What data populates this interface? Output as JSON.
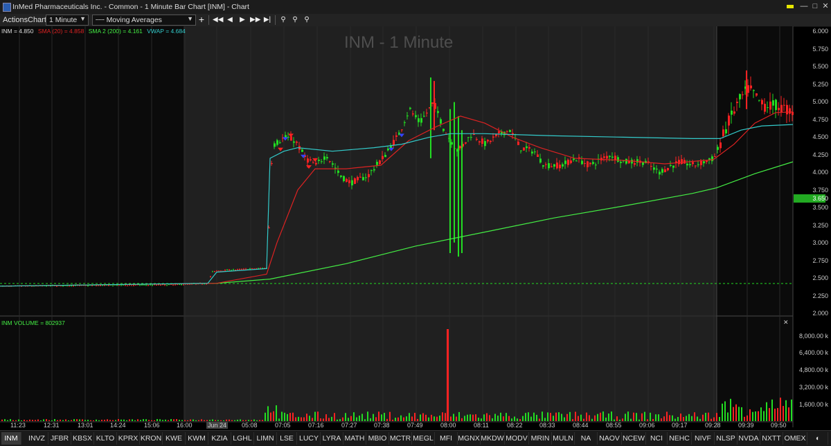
{
  "window": {
    "title": "InMed Pharmaceuticals Inc. - Common - 1 Minute Bar Chart [INM] - Chart"
  },
  "toolbar": {
    "actions": "Actions",
    "chart": "Chart",
    "interval": "1 Minute",
    "indicator": "Moving Averages"
  },
  "chart": {
    "watermark": "INM - 1 Minute",
    "legend": {
      "symbol": "INM = 4.850",
      "sma20": "SMA (20) = 4.858",
      "sma200": "SMA 2 (200) = 4.161",
      "vwap": "VWAP = 4.684"
    },
    "price_ticks": [
      "6.000",
      "5.750",
      "5.500",
      "5.250",
      "5.000",
      "4.750",
      "4.500",
      "4.250",
      "4.000",
      "3.750",
      "3.650",
      "3.500",
      "3.250",
      "3.000",
      "2.750",
      "2.500",
      "2.250",
      "2.000"
    ],
    "price_marker": "3.650",
    "volume_legend": "INM VOLUME = 802937",
    "volume_ticks": [
      "8,000.00 k",
      "6,400.00 k",
      "4,800.00 k",
      "3,200.00 k",
      "1,600.00 k"
    ],
    "time_ticks": [
      "11:23",
      "12:31",
      "13:01",
      "14:24",
      "15:06",
      "16:00",
      "Jun 24",
      "05:08",
      "07:05",
      "07:16",
      "07:27",
      "07:38",
      "07:49",
      "08:00",
      "08:11",
      "08:22",
      "08:33",
      "08:44",
      "08:55",
      "09:06",
      "09:17",
      "09:28",
      "09:39",
      "09:50"
    ],
    "colors": {
      "up": "#22dd22",
      "down": "#ff2222",
      "sma20": "#dd2222",
      "sma200": "#44ee44",
      "vwap": "#33cccc",
      "marker_bg": "#22aa22"
    }
  },
  "tabs": [
    "INM",
    "INVZ",
    "JFBR",
    "KBSX",
    "KLTO",
    "KPRX",
    "KRON",
    "KWE",
    "KWM",
    "KZIA",
    "LGHL",
    "LIMN",
    "LSE",
    "LUCY",
    "LYRA",
    "MATH",
    "MBIO",
    "MCTR",
    "MEGL",
    "MFI",
    "MGNX",
    "MKDW",
    "MODV",
    "MRIN",
    "MULN",
    "NA",
    "NAOV",
    "NCEW",
    "NCI",
    "NEHC",
    "NIVF",
    "NLSP",
    "NVDA",
    "NXTT",
    "OMEX"
  ]
}
